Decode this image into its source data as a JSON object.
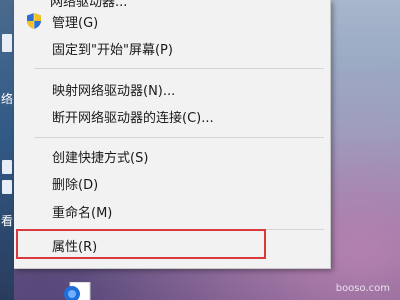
{
  "menu": {
    "partial_top_label": "网络驱动器...",
    "items": [
      {
        "label": "管理(G)",
        "icon": "uac-shield-icon"
      },
      {
        "label": "固定到\"开始\"屏幕(P)"
      },
      {
        "label": "映射网络驱动器(N)..."
      },
      {
        "label": "断开网络驱动器的连接(C)..."
      },
      {
        "label": "创建快捷方式(S)"
      },
      {
        "label": "删除(D)"
      },
      {
        "label": "重命名(M)"
      },
      {
        "label": "属性(R)",
        "highlighted": true
      }
    ]
  },
  "desktop": {
    "left_edge_glyphs": [
      "络",
      "看"
    ]
  },
  "watermark": "booso.com",
  "colors": {
    "menu_background": "#f2f2f2",
    "highlight_border": "#d9393d",
    "separator": "#d5d5d5"
  }
}
